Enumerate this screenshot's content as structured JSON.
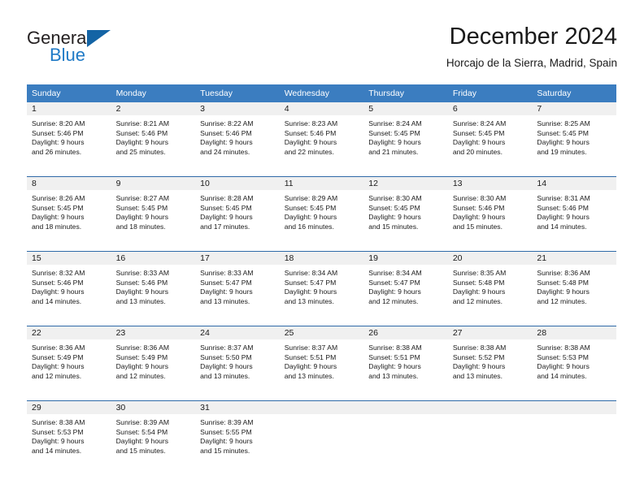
{
  "brand": {
    "name_part1": "General",
    "name_part2": "Blue",
    "triangle_color": "#1464a5",
    "blue_text_color": "#1f7ac6"
  },
  "header": {
    "month_title": "December 2024",
    "location": "Horcajo de la Sierra, Madrid, Spain"
  },
  "theme": {
    "header_bg": "#3b7dc0",
    "separator": "#2f6aa8",
    "daynum_band": "#f0f0f0",
    "text": "#1a1a1a"
  },
  "calendar": {
    "weekday_headers": [
      "Sunday",
      "Monday",
      "Tuesday",
      "Wednesday",
      "Thursday",
      "Friday",
      "Saturday"
    ],
    "weeks": [
      [
        {
          "day": "1",
          "sunrise": "Sunrise: 8:20 AM",
          "sunset": "Sunset: 5:46 PM",
          "daylight_line1": "Daylight: 9 hours",
          "daylight_line2": "and 26 minutes."
        },
        {
          "day": "2",
          "sunrise": "Sunrise: 8:21 AM",
          "sunset": "Sunset: 5:46 PM",
          "daylight_line1": "Daylight: 9 hours",
          "daylight_line2": "and 25 minutes."
        },
        {
          "day": "3",
          "sunrise": "Sunrise: 8:22 AM",
          "sunset": "Sunset: 5:46 PM",
          "daylight_line1": "Daylight: 9 hours",
          "daylight_line2": "and 24 minutes."
        },
        {
          "day": "4",
          "sunrise": "Sunrise: 8:23 AM",
          "sunset": "Sunset: 5:46 PM",
          "daylight_line1": "Daylight: 9 hours",
          "daylight_line2": "and 22 minutes."
        },
        {
          "day": "5",
          "sunrise": "Sunrise: 8:24 AM",
          "sunset": "Sunset: 5:45 PM",
          "daylight_line1": "Daylight: 9 hours",
          "daylight_line2": "and 21 minutes."
        },
        {
          "day": "6",
          "sunrise": "Sunrise: 8:24 AM",
          "sunset": "Sunset: 5:45 PM",
          "daylight_line1": "Daylight: 9 hours",
          "daylight_line2": "and 20 minutes."
        },
        {
          "day": "7",
          "sunrise": "Sunrise: 8:25 AM",
          "sunset": "Sunset: 5:45 PM",
          "daylight_line1": "Daylight: 9 hours",
          "daylight_line2": "and 19 minutes."
        }
      ],
      [
        {
          "day": "8",
          "sunrise": "Sunrise: 8:26 AM",
          "sunset": "Sunset: 5:45 PM",
          "daylight_line1": "Daylight: 9 hours",
          "daylight_line2": "and 18 minutes."
        },
        {
          "day": "9",
          "sunrise": "Sunrise: 8:27 AM",
          "sunset": "Sunset: 5:45 PM",
          "daylight_line1": "Daylight: 9 hours",
          "daylight_line2": "and 18 minutes."
        },
        {
          "day": "10",
          "sunrise": "Sunrise: 8:28 AM",
          "sunset": "Sunset: 5:45 PM",
          "daylight_line1": "Daylight: 9 hours",
          "daylight_line2": "and 17 minutes."
        },
        {
          "day": "11",
          "sunrise": "Sunrise: 8:29 AM",
          "sunset": "Sunset: 5:45 PM",
          "daylight_line1": "Daylight: 9 hours",
          "daylight_line2": "and 16 minutes."
        },
        {
          "day": "12",
          "sunrise": "Sunrise: 8:30 AM",
          "sunset": "Sunset: 5:45 PM",
          "daylight_line1": "Daylight: 9 hours",
          "daylight_line2": "and 15 minutes."
        },
        {
          "day": "13",
          "sunrise": "Sunrise: 8:30 AM",
          "sunset": "Sunset: 5:46 PM",
          "daylight_line1": "Daylight: 9 hours",
          "daylight_line2": "and 15 minutes."
        },
        {
          "day": "14",
          "sunrise": "Sunrise: 8:31 AM",
          "sunset": "Sunset: 5:46 PM",
          "daylight_line1": "Daylight: 9 hours",
          "daylight_line2": "and 14 minutes."
        }
      ],
      [
        {
          "day": "15",
          "sunrise": "Sunrise: 8:32 AM",
          "sunset": "Sunset: 5:46 PM",
          "daylight_line1": "Daylight: 9 hours",
          "daylight_line2": "and 14 minutes."
        },
        {
          "day": "16",
          "sunrise": "Sunrise: 8:33 AM",
          "sunset": "Sunset: 5:46 PM",
          "daylight_line1": "Daylight: 9 hours",
          "daylight_line2": "and 13 minutes."
        },
        {
          "day": "17",
          "sunrise": "Sunrise: 8:33 AM",
          "sunset": "Sunset: 5:47 PM",
          "daylight_line1": "Daylight: 9 hours",
          "daylight_line2": "and 13 minutes."
        },
        {
          "day": "18",
          "sunrise": "Sunrise: 8:34 AM",
          "sunset": "Sunset: 5:47 PM",
          "daylight_line1": "Daylight: 9 hours",
          "daylight_line2": "and 13 minutes."
        },
        {
          "day": "19",
          "sunrise": "Sunrise: 8:34 AM",
          "sunset": "Sunset: 5:47 PM",
          "daylight_line1": "Daylight: 9 hours",
          "daylight_line2": "and 12 minutes."
        },
        {
          "day": "20",
          "sunrise": "Sunrise: 8:35 AM",
          "sunset": "Sunset: 5:48 PM",
          "daylight_line1": "Daylight: 9 hours",
          "daylight_line2": "and 12 minutes."
        },
        {
          "day": "21",
          "sunrise": "Sunrise: 8:36 AM",
          "sunset": "Sunset: 5:48 PM",
          "daylight_line1": "Daylight: 9 hours",
          "daylight_line2": "and 12 minutes."
        }
      ],
      [
        {
          "day": "22",
          "sunrise": "Sunrise: 8:36 AM",
          "sunset": "Sunset: 5:49 PM",
          "daylight_line1": "Daylight: 9 hours",
          "daylight_line2": "and 12 minutes."
        },
        {
          "day": "23",
          "sunrise": "Sunrise: 8:36 AM",
          "sunset": "Sunset: 5:49 PM",
          "daylight_line1": "Daylight: 9 hours",
          "daylight_line2": "and 12 minutes."
        },
        {
          "day": "24",
          "sunrise": "Sunrise: 8:37 AM",
          "sunset": "Sunset: 5:50 PM",
          "daylight_line1": "Daylight: 9 hours",
          "daylight_line2": "and 13 minutes."
        },
        {
          "day": "25",
          "sunrise": "Sunrise: 8:37 AM",
          "sunset": "Sunset: 5:51 PM",
          "daylight_line1": "Daylight: 9 hours",
          "daylight_line2": "and 13 minutes."
        },
        {
          "day": "26",
          "sunrise": "Sunrise: 8:38 AM",
          "sunset": "Sunset: 5:51 PM",
          "daylight_line1": "Daylight: 9 hours",
          "daylight_line2": "and 13 minutes."
        },
        {
          "day": "27",
          "sunrise": "Sunrise: 8:38 AM",
          "sunset": "Sunset: 5:52 PM",
          "daylight_line1": "Daylight: 9 hours",
          "daylight_line2": "and 13 minutes."
        },
        {
          "day": "28",
          "sunrise": "Sunrise: 8:38 AM",
          "sunset": "Sunset: 5:53 PM",
          "daylight_line1": "Daylight: 9 hours",
          "daylight_line2": "and 14 minutes."
        }
      ],
      [
        {
          "day": "29",
          "sunrise": "Sunrise: 8:38 AM",
          "sunset": "Sunset: 5:53 PM",
          "daylight_line1": "Daylight: 9 hours",
          "daylight_line2": "and 14 minutes."
        },
        {
          "day": "30",
          "sunrise": "Sunrise: 8:39 AM",
          "sunset": "Sunset: 5:54 PM",
          "daylight_line1": "Daylight: 9 hours",
          "daylight_line2": "and 15 minutes."
        },
        {
          "day": "31",
          "sunrise": "Sunrise: 8:39 AM",
          "sunset": "Sunset: 5:55 PM",
          "daylight_line1": "Daylight: 9 hours",
          "daylight_line2": "and 15 minutes."
        },
        {
          "day": "",
          "sunrise": "",
          "sunset": "",
          "daylight_line1": "",
          "daylight_line2": ""
        },
        {
          "day": "",
          "sunrise": "",
          "sunset": "",
          "daylight_line1": "",
          "daylight_line2": ""
        },
        {
          "day": "",
          "sunrise": "",
          "sunset": "",
          "daylight_line1": "",
          "daylight_line2": ""
        },
        {
          "day": "",
          "sunrise": "",
          "sunset": "",
          "daylight_line1": "",
          "daylight_line2": ""
        }
      ]
    ]
  }
}
